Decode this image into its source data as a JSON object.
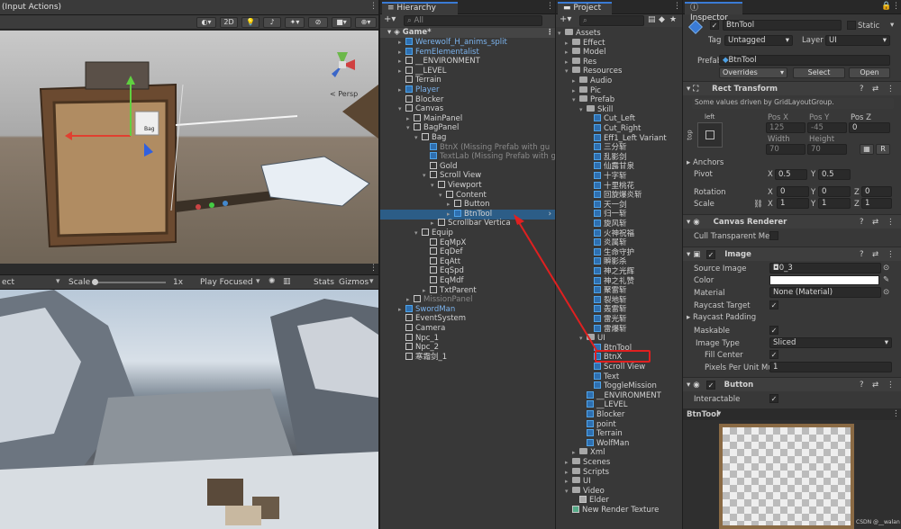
{
  "scene": {
    "tab_title": "(Input Actions)",
    "btn_2d": "2D",
    "persp": "< Persp",
    "tooltip_bag": "Bag"
  },
  "game": {
    "dropdown": "ect",
    "scale_label": "Scale",
    "scale_value": "1x",
    "play_mode": "Play Focused",
    "stats": "Stats",
    "gizmos": "Gizmos"
  },
  "hierarchy": {
    "tab": "Hierarchy",
    "search_placeholder": "All",
    "root": "Game*",
    "items": [
      {
        "label": "Werewolf_H_anims_split",
        "indent": 2,
        "style": "blue",
        "icon": "cube-blue",
        "arrow": "▸"
      },
      {
        "label": "FemElementalist",
        "indent": 2,
        "style": "blue",
        "icon": "cube-blue",
        "arrow": "▸"
      },
      {
        "label": "__ENVIRONMENT",
        "indent": 2,
        "style": "",
        "icon": "cube",
        "arrow": "▸"
      },
      {
        "label": "__LEVEL",
        "indent": 2,
        "style": "",
        "icon": "cube",
        "arrow": "▸"
      },
      {
        "label": "Terrain",
        "indent": 2,
        "style": "",
        "icon": "cube",
        "arrow": ""
      },
      {
        "label": "Player",
        "indent": 2,
        "style": "blue",
        "icon": "cube-blue",
        "arrow": "▸"
      },
      {
        "label": "Blocker",
        "indent": 2,
        "style": "",
        "icon": "cube",
        "arrow": ""
      },
      {
        "label": "Canvas",
        "indent": 2,
        "style": "",
        "icon": "cube",
        "arrow": "▾"
      },
      {
        "label": "MainPanel",
        "indent": 3,
        "style": "",
        "icon": "cube",
        "arrow": "▸"
      },
      {
        "label": "BagPanel",
        "indent": 3,
        "style": "",
        "icon": "cube",
        "arrow": "▾"
      },
      {
        "label": "Bag",
        "indent": 4,
        "style": "",
        "icon": "cube",
        "arrow": "▾"
      },
      {
        "label": "BtnX (Missing Prefab with gu",
        "indent": 5,
        "style": "grey",
        "icon": "cube-blue",
        "arrow": ""
      },
      {
        "label": "TextLab (Missing Prefab with g",
        "indent": 5,
        "style": "grey",
        "icon": "cube-blue",
        "arrow": ""
      },
      {
        "label": "Gold",
        "indent": 5,
        "style": "",
        "icon": "cube",
        "arrow": ""
      },
      {
        "label": "Scroll View",
        "indent": 5,
        "style": "",
        "icon": "cube",
        "arrow": "▾"
      },
      {
        "label": "Viewport",
        "indent": 6,
        "style": "",
        "icon": "cube",
        "arrow": "▾"
      },
      {
        "label": "Content",
        "indent": 7,
        "style": "",
        "icon": "cube",
        "arrow": "▾"
      },
      {
        "label": "Button",
        "indent": 8,
        "style": "",
        "icon": "cube",
        "arrow": "▸"
      },
      {
        "label": "BtnTool",
        "indent": 8,
        "style": "sel",
        "icon": "cube-blue",
        "arrow": "▸"
      },
      {
        "label": "Scrollbar Vertica",
        "indent": 6,
        "style": "",
        "icon": "cube",
        "arrow": "▸"
      },
      {
        "label": "Equip",
        "indent": 4,
        "style": "",
        "icon": "cube",
        "arrow": "▾"
      },
      {
        "label": "EqMpX",
        "indent": 5,
        "style": "",
        "icon": "cube",
        "arrow": ""
      },
      {
        "label": "EqDef",
        "indent": 5,
        "style": "",
        "icon": "cube",
        "arrow": ""
      },
      {
        "label": "EqAtt",
        "indent": 5,
        "style": "",
        "icon": "cube",
        "arrow": ""
      },
      {
        "label": "EqSpd",
        "indent": 5,
        "style": "",
        "icon": "cube",
        "arrow": ""
      },
      {
        "label": "EqMdf",
        "indent": 5,
        "style": "",
        "icon": "cube",
        "arrow": ""
      },
      {
        "label": "TxtParent",
        "indent": 5,
        "style": "",
        "icon": "cube",
        "arrow": "▸"
      },
      {
        "label": "MissionPanel",
        "indent": 3,
        "style": "grey",
        "icon": "cube",
        "arrow": "▸"
      },
      {
        "label": "SwordMan",
        "indent": 2,
        "style": "blue",
        "icon": "cube-blue",
        "arrow": "▸"
      },
      {
        "label": "EventSystem",
        "indent": 2,
        "style": "",
        "icon": "cube",
        "arrow": ""
      },
      {
        "label": "Camera",
        "indent": 2,
        "style": "",
        "icon": "cube",
        "arrow": ""
      },
      {
        "label": "Npc_1",
        "indent": 2,
        "style": "",
        "icon": "cube",
        "arrow": ""
      },
      {
        "label": "Npc_2",
        "indent": 2,
        "style": "",
        "icon": "cube",
        "arrow": ""
      },
      {
        "label": "寒霜剑_1",
        "indent": 2,
        "style": "",
        "icon": "cube",
        "arrow": ""
      }
    ]
  },
  "project": {
    "tab": "Project",
    "items": [
      {
        "label": "Assets",
        "indent": 0,
        "icon": "folder",
        "arrow": "▾"
      },
      {
        "label": "Effect",
        "indent": 1,
        "icon": "folder",
        "arrow": "▸"
      },
      {
        "label": "Model",
        "indent": 1,
        "icon": "folder",
        "arrow": "▸"
      },
      {
        "label": "Res",
        "indent": 1,
        "icon": "folder",
        "arrow": "▸"
      },
      {
        "label": "Resources",
        "indent": 1,
        "icon": "folder",
        "arrow": "▾"
      },
      {
        "label": "Audio",
        "indent": 2,
        "icon": "folder",
        "arrow": "▸"
      },
      {
        "label": "Pic",
        "indent": 2,
        "icon": "folder",
        "arrow": "▸"
      },
      {
        "label": "Prefab",
        "indent": 2,
        "icon": "folder",
        "arrow": "▾"
      },
      {
        "label": "Skill",
        "indent": 3,
        "icon": "folder",
        "arrow": "▾"
      },
      {
        "label": "Cut_Left",
        "indent": 4,
        "icon": "cube-blue",
        "arrow": ""
      },
      {
        "label": "Cut_Right",
        "indent": 4,
        "icon": "cube-blue",
        "arrow": ""
      },
      {
        "label": "Eff1_Left Variant",
        "indent": 4,
        "icon": "cube-blue",
        "arrow": ""
      },
      {
        "label": "三分斩",
        "indent": 4,
        "icon": "cube-blue",
        "arrow": ""
      },
      {
        "label": "乱影剑",
        "indent": 4,
        "icon": "cube-blue",
        "arrow": ""
      },
      {
        "label": "仙露甘泉",
        "indent": 4,
        "icon": "cube-blue",
        "arrow": ""
      },
      {
        "label": "十字斩",
        "indent": 4,
        "icon": "cube-blue",
        "arrow": ""
      },
      {
        "label": "十里桃花",
        "indent": 4,
        "icon": "cube-blue",
        "arrow": ""
      },
      {
        "label": "回旋爆炎斩",
        "indent": 4,
        "icon": "cube-blue",
        "arrow": ""
      },
      {
        "label": "天一剑",
        "indent": 4,
        "icon": "cube-blue",
        "arrow": ""
      },
      {
        "label": "归一斩",
        "indent": 4,
        "icon": "cube-blue",
        "arrow": ""
      },
      {
        "label": "旋风斩",
        "indent": 4,
        "icon": "cube-blue",
        "arrow": ""
      },
      {
        "label": "火神祝福",
        "indent": 4,
        "icon": "cube-blue",
        "arrow": ""
      },
      {
        "label": "炎属斩",
        "indent": 4,
        "icon": "cube-blue",
        "arrow": ""
      },
      {
        "label": "生命守护",
        "indent": 4,
        "icon": "cube-blue",
        "arrow": ""
      },
      {
        "label": "瞬影杀",
        "indent": 4,
        "icon": "cube-blue",
        "arrow": ""
      },
      {
        "label": "神之光辉",
        "indent": 4,
        "icon": "cube-blue",
        "arrow": ""
      },
      {
        "label": "神之礼赞",
        "indent": 4,
        "icon": "cube-blue",
        "arrow": ""
      },
      {
        "label": "聚雷斩",
        "indent": 4,
        "icon": "cube-blue",
        "arrow": ""
      },
      {
        "label": "裂地斩",
        "indent": 4,
        "icon": "cube-blue",
        "arrow": ""
      },
      {
        "label": "轰雷斩",
        "indent": 4,
        "icon": "cube-blue",
        "arrow": ""
      },
      {
        "label": "雷光斩",
        "indent": 4,
        "icon": "cube-blue",
        "arrow": ""
      },
      {
        "label": "雷爆斩",
        "indent": 4,
        "icon": "cube-blue",
        "arrow": ""
      },
      {
        "label": "UI",
        "indent": 3,
        "icon": "folder",
        "arrow": "▾"
      },
      {
        "label": "BtnTool",
        "indent": 4,
        "icon": "cube-blue",
        "arrow": "",
        "boxed": true
      },
      {
        "label": "BtnX",
        "indent": 4,
        "icon": "cube-blue",
        "arrow": ""
      },
      {
        "label": "Scroll View",
        "indent": 4,
        "icon": "cube-blue",
        "arrow": ""
      },
      {
        "label": "Text",
        "indent": 4,
        "icon": "cube-blue",
        "arrow": ""
      },
      {
        "label": "ToggleMission",
        "indent": 4,
        "icon": "cube-blue",
        "arrow": ""
      },
      {
        "label": "__ENVIRONMENT",
        "indent": 3,
        "icon": "cube-blue",
        "arrow": ""
      },
      {
        "label": "__LEVEL",
        "indent": 3,
        "icon": "cube-blue",
        "arrow": ""
      },
      {
        "label": "Blocker",
        "indent": 3,
        "icon": "cube-blue",
        "arrow": ""
      },
      {
        "label": "point",
        "indent": 3,
        "icon": "cube-blue",
        "arrow": ""
      },
      {
        "label": "Terrain",
        "indent": 3,
        "icon": "cube-blue",
        "arrow": ""
      },
      {
        "label": "WolfMan",
        "indent": 3,
        "icon": "cube-blue",
        "arrow": ""
      },
      {
        "label": "Xml",
        "indent": 2,
        "icon": "folder",
        "arrow": "▸"
      },
      {
        "label": "Scenes",
        "indent": 1,
        "icon": "folder",
        "arrow": "▸"
      },
      {
        "label": "Scripts",
        "indent": 1,
        "icon": "folder",
        "arrow": "▸"
      },
      {
        "label": "UI",
        "indent": 1,
        "icon": "folder",
        "arrow": "▸"
      },
      {
        "label": "Video",
        "indent": 1,
        "icon": "folder",
        "arrow": "▾"
      },
      {
        "label": "Elder",
        "indent": 2,
        "icon": "video",
        "arrow": ""
      },
      {
        "label": "New Render Texture",
        "indent": 1,
        "icon": "texture",
        "arrow": ""
      }
    ]
  },
  "inspector": {
    "tab": "Inspector",
    "name": "BtnTool",
    "static": "Static",
    "tag_label": "Tag",
    "tag_value": "Untagged",
    "layer_label": "Layer",
    "layer_value": "UI",
    "prefab_label": "Prefab",
    "prefab_value": "BtnTool",
    "overrides": "Overrides",
    "select": "Select",
    "open": "Open",
    "rect_transform": "Rect Transform",
    "driven_note": "Some values driven by GridLayoutGroup.",
    "anchor_h": "left",
    "anchor_v": "top",
    "pos_x_label": "Pos X",
    "pos_y_label": "Pos Y",
    "pos_z_label": "Pos Z",
    "pos_x": "125",
    "pos_y": "-45",
    "pos_z": "0",
    "width_label": "Width",
    "height_label": "Height",
    "width": "70",
    "height": "70",
    "anchors": "Anchors",
    "pivot": "Pivot",
    "pivot_x": "0.5",
    "pivot_y": "0.5",
    "rotation": "Rotation",
    "rot_x": "0",
    "rot_y": "0",
    "rot_z": "0",
    "scale": "Scale",
    "scale_x": "1",
    "scale_y": "1",
    "scale_z": "1",
    "canvas_renderer": "Canvas Renderer",
    "cull_transparent": "Cull Transparent Me",
    "image": "Image",
    "source_image_label": "Source Image",
    "source_image": "0_3",
    "color_label": "Color",
    "material_label": "Material",
    "material": "None (Material)",
    "raycast_target": "Raycast Target",
    "raycast_padding": "Raycast Padding",
    "maskable": "Maskable",
    "image_type_label": "Image Type",
    "image_type": "Sliced",
    "fill_center": "Fill Center",
    "ppu_label": "Pixels Per Unit Mu",
    "ppu": "1",
    "button": "Button",
    "interactable": "Interactable",
    "preview_name": "BtnTool",
    "watermark": "CSDN @__walan"
  }
}
